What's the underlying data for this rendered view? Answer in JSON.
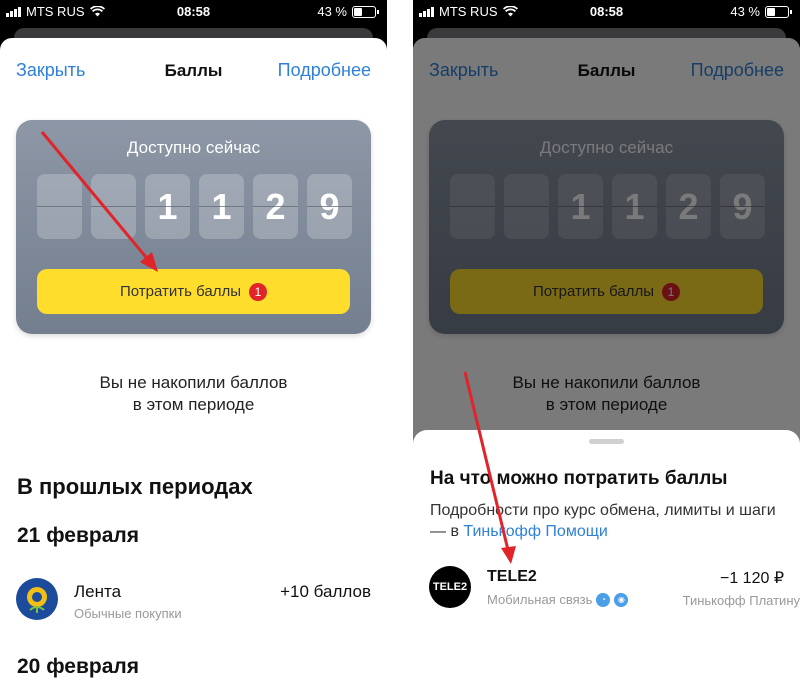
{
  "status_bar": {
    "carrier": "MTS RUS",
    "time": "08:58",
    "battery": "43 %"
  },
  "nav": {
    "close_label": "Закрыть",
    "title": "Баллы",
    "more_label": "Подробнее"
  },
  "points_card": {
    "title": "Доступно сейчас",
    "digits": [
      "",
      "",
      "1",
      "1",
      "2",
      "9"
    ],
    "spend_button_label": "Потратить баллы",
    "spend_badge": "1"
  },
  "empty_state": {
    "line1": "Вы не накопили баллов",
    "line2": "в этом периоде"
  },
  "history": {
    "title": "В прошлых периодах",
    "groups": [
      {
        "date": "21 февраля",
        "items": [
          {
            "name": "Лента",
            "category": "Обычные покупки",
            "points": "+10 баллов"
          }
        ]
      },
      {
        "date": "20 февраля"
      }
    ]
  },
  "spend_sheet": {
    "title": "На что можно потратить баллы",
    "description": "Подробности про курс обмена, лимиты и шаги — в ",
    "link": "Тинькофф Помощи",
    "offer": {
      "logo_text": "TELE2",
      "name": "TELE2",
      "category": "Мобильная связь",
      "price": "−1 120 ₽",
      "bank": "Тинькофф Платину"
    }
  },
  "colors": {
    "accent": "#2f80d8",
    "button_yellow": "#ffdd2d",
    "badge_red": "#e0242a",
    "arrow_red": "#e0242a"
  }
}
